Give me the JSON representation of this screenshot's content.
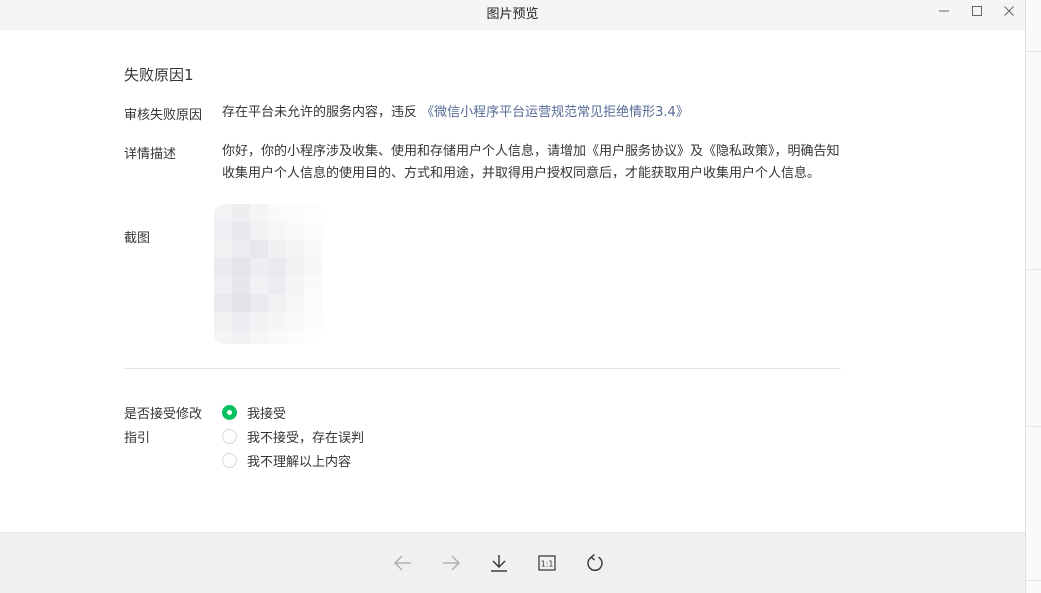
{
  "window": {
    "title": "图片预览"
  },
  "section": {
    "title": "失败原因1"
  },
  "reason": {
    "label": "审核失败原因",
    "text": "存在平台未允许的服务内容，违反",
    "link": "《微信小程序平台运营规范常见拒绝情形3.4》"
  },
  "detail": {
    "label": "详情描述",
    "text": "你好，你的小程序涉及收集、使用和存储用户个人信息，请增加《用户服务协议》及《隐私政策》，明确告知收集用户个人信息的使用目的、方式和用途，并取得用户授权同意后，才能获取用户收集用户个人信息。"
  },
  "screenshot": {
    "label": "截图"
  },
  "accept": {
    "label_line1": "是否接受修改",
    "label_line2": "指引",
    "options": [
      {
        "label": "我接受",
        "checked": true
      },
      {
        "label": "我不接受，存在误判",
        "checked": false
      },
      {
        "label": "我不理解以上内容",
        "checked": false
      }
    ]
  },
  "toolbar": {
    "actual_size_label": "1:1"
  },
  "colors": {
    "accent_green": "#07c160",
    "link_blue": "#576b95"
  }
}
